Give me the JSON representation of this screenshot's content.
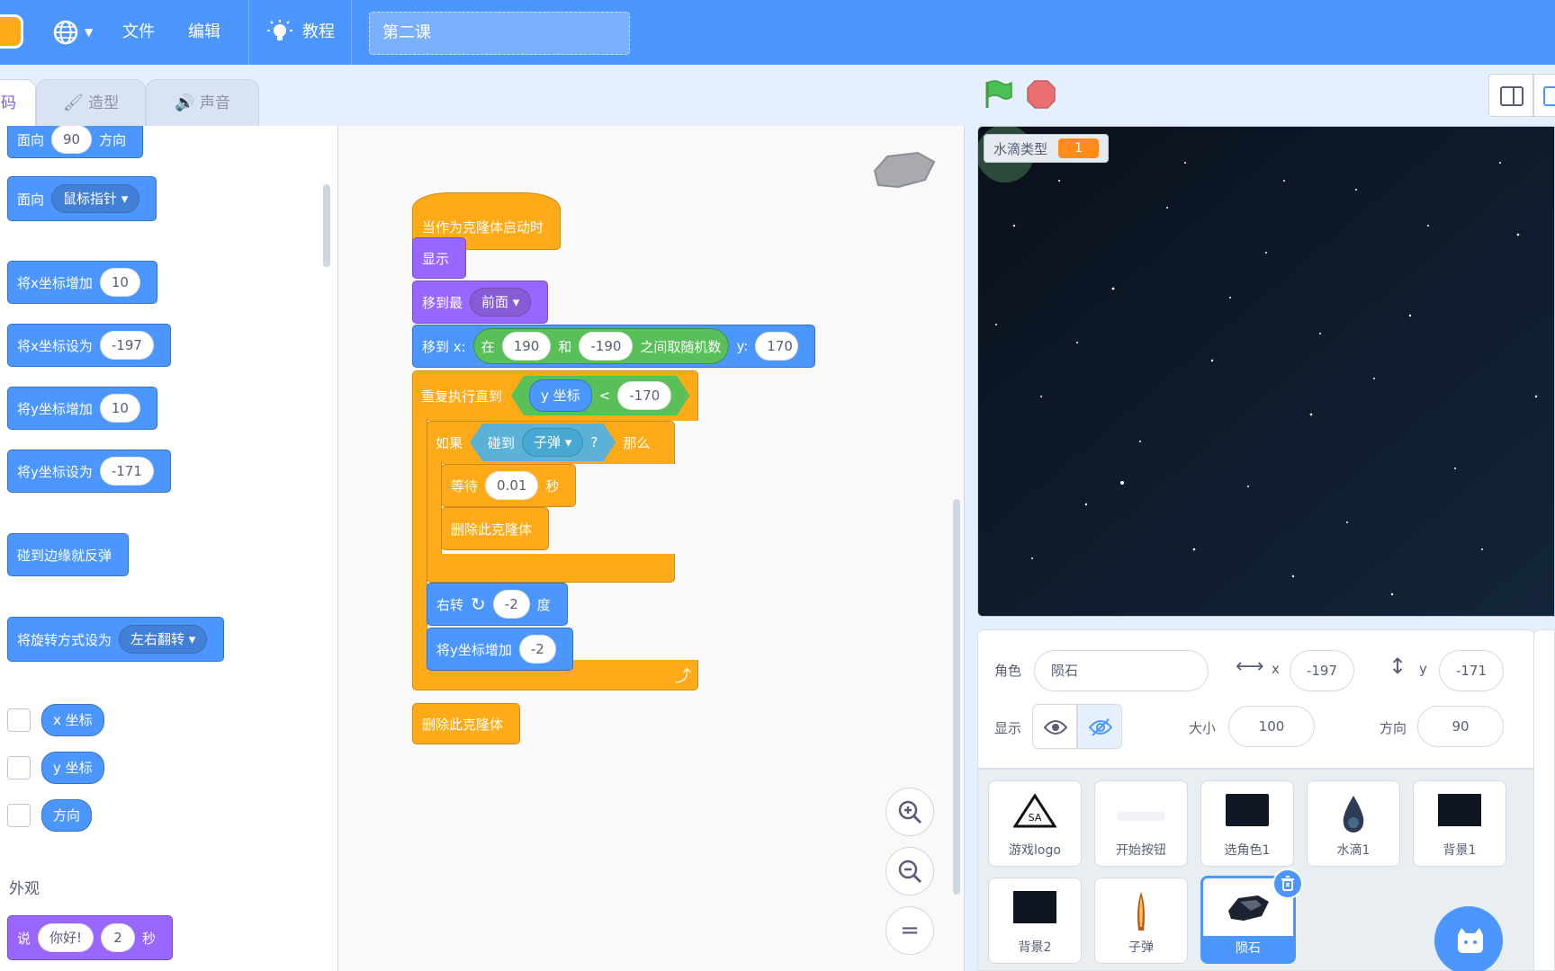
{
  "menubar": {
    "globe_icon": "globe-icon",
    "file": "文件",
    "edit": "编辑",
    "tutorial": "教程",
    "project_title": "第二课"
  },
  "tabs": {
    "code": "码",
    "costumes": "造型",
    "sounds": "声音"
  },
  "palette": {
    "point_dir": {
      "label1": "面向",
      "value": "90",
      "label2": "方向"
    },
    "point_towards": {
      "label": "面向",
      "option": "鼠标指针"
    },
    "change_x": {
      "label": "将x坐标增加",
      "value": "10"
    },
    "set_x": {
      "label": "将x坐标设为",
      "value": "-197"
    },
    "change_y": {
      "label": "将y坐标增加",
      "value": "10"
    },
    "set_y": {
      "label": "将y坐标设为",
      "value": "-171"
    },
    "bounce": {
      "label": "碰到边缘就反弹"
    },
    "rotation": {
      "label": "将旋转方式设为",
      "option": "左右翻转"
    },
    "rep_x": "x 坐标",
    "rep_y": "y 坐标",
    "rep_dir": "方向",
    "looks_heading": "外观",
    "say": {
      "label": "说",
      "msg": "你好!",
      "secs": "2",
      "unit": "秒"
    }
  },
  "script": {
    "hat": "当作为克隆体启动时",
    "show": "显示",
    "goto_front": {
      "label": "移到最",
      "option": "前面"
    },
    "goto_xy": {
      "label": "移到 x:",
      "rand_in": "在",
      "from": "190",
      "and": "和",
      "to": "-190",
      "rand_label": "之间取随机数",
      "y_label": "y:",
      "y": "170"
    },
    "repeat_until": {
      "label": "重复执行直到",
      "reporter": "y 坐标",
      "op": "<",
      "value": "-170"
    },
    "if": {
      "label": "如果",
      "touch": "碰到",
      "target": "子弹",
      "q": "?",
      "then": "那么"
    },
    "wait": {
      "label": "等待",
      "value": "0.01",
      "unit": "秒"
    },
    "delete_inner": "删除此克隆体",
    "turn": {
      "label": "右转",
      "value": "-2",
      "unit": "度"
    },
    "change_y": {
      "label": "将y坐标增加",
      "value": "-2"
    },
    "delete_end": "删除此克隆体"
  },
  "stage": {
    "monitor_label": "水滴类型",
    "monitor_value": "1"
  },
  "sprite_info": {
    "sprite_label": "角色",
    "sprite_name": "陨石",
    "x_label": "x",
    "x": "-197",
    "y_label": "y",
    "y": "-171",
    "show_label": "显示",
    "size_label": "大小",
    "size": "100",
    "dir_label": "方向",
    "dir": "90"
  },
  "sprites": [
    {
      "name": "游戏logo"
    },
    {
      "name": "开始按钮"
    },
    {
      "name": "选角色1"
    },
    {
      "name": "水滴1"
    },
    {
      "name": "背景1"
    },
    {
      "name": "背景2"
    },
    {
      "name": "子弹"
    },
    {
      "name": "陨石",
      "selected": true
    }
  ],
  "colors": {
    "menubar": "#4c97ff",
    "motion": "#4c97ff",
    "looks": "#9966ff",
    "control": "#ffab19",
    "sensing": "#5cb1d6",
    "operators": "#59c059"
  }
}
